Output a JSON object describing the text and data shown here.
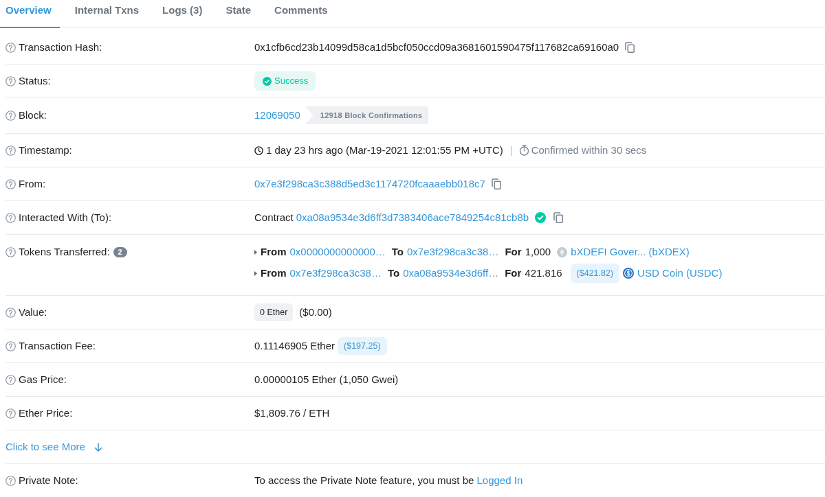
{
  "tabs": [
    {
      "label": "Overview",
      "selected": true
    },
    {
      "label": "Internal Txns",
      "selected": false
    },
    {
      "label": "Logs (3)",
      "selected": false
    },
    {
      "label": "State",
      "selected": false
    },
    {
      "label": "Comments",
      "selected": false
    }
  ],
  "details": [
    {
      "kind": "hash",
      "label": "Transaction Hash:",
      "value": "0x1cfb6cd23b14099d58ca1d5bcf050ccd09a3681601590475f117682ca69160a0"
    },
    {
      "kind": "status",
      "label": "Status:",
      "status": "Success"
    },
    {
      "kind": "block",
      "label": "Block:",
      "block": "12069050",
      "confirmations": "12918 Block Confirmations"
    },
    {
      "kind": "timestamp",
      "label": "Timestamp:",
      "age": "1 day 23 hrs ago (Mar-19-2021 12:01:55 PM +UTC)",
      "separator": "|",
      "confirmed": "Confirmed within 30 secs"
    },
    {
      "kind": "address",
      "label": "From:",
      "address": "0x7e3f298ca3c388d5ed3c1174720fcaaaebb018c7"
    },
    {
      "kind": "contract",
      "label": "Interacted With (To):",
      "prefix": "Contract",
      "address": "0xa08a9534e3d6ff3d7383406ace7849254c81cb8b",
      "verified": true
    },
    {
      "kind": "tokens",
      "label": "Tokens Transferred:",
      "count": "2",
      "transfers": [
        {
          "kind": "generic",
          "from_label": "From",
          "from": "0x0000000000000…",
          "to_label": "To",
          "to": "0x7e3f298ca3c38…",
          "for_label": "For",
          "amount": "1,000",
          "token": "bXDEFI Gover... (bXDEX)"
        },
        {
          "kind": "usd",
          "from_label": "From",
          "from": "0x7e3f298ca3c38…",
          "to_label": "To",
          "to": "0xa08a9534e3d6ff…",
          "for_label": "For",
          "amount": "421.816",
          "usd_value": "($421.82)",
          "token": "USD Coin (USDC)"
        }
      ]
    },
    {
      "kind": "value",
      "label": "Value:",
      "amount": "0 Ether",
      "usd_value": "($0.00)"
    },
    {
      "kind": "fee",
      "label": "Transaction Fee:",
      "amount": "0.11146905 Ether",
      "usd_value": "($197.25)"
    },
    {
      "kind": "text",
      "label": "Gas Price:",
      "value": "0.00000105 Ether (1,050 Gwei)"
    },
    {
      "kind": "text",
      "label": "Ether Price:",
      "value": "$1,809.76 / ETH"
    },
    {
      "kind": "more",
      "link": "Click to see More"
    },
    {
      "kind": "note",
      "label": "Private Note:",
      "text": "To access the Private Note feature, you must be",
      "link": "Logged In"
    }
  ]
}
